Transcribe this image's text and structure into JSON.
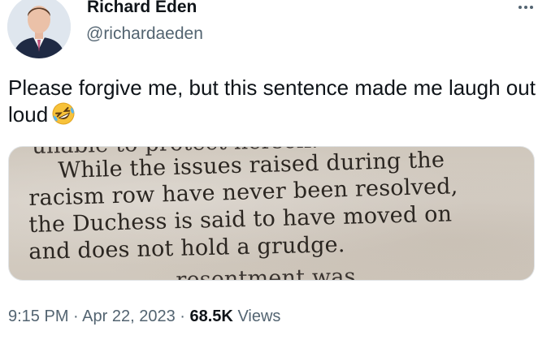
{
  "author": {
    "name": "Richard Eden",
    "handle": "@richardaeden"
  },
  "tweet": {
    "text": "Please forgive me, but this sentence made me laugh out loud",
    "emoji": "rolling-on-the-floor-laughing-emoji"
  },
  "media": {
    "lines": [
      "unable to protect herself.",
      "While the issues raised during the",
      "racism row have never been resolved,",
      "the Duchess is said to have moved on",
      "and does not hold a grudge.",
      "... resentment was"
    ]
  },
  "meta": {
    "time": "9:15 PM",
    "separator": "·",
    "date": "Apr 22, 2023",
    "views_count": "68.5K",
    "views_label": "Views"
  },
  "icons": {
    "more": "more-horizontal-icon"
  },
  "colors": {
    "text_primary": "#0f1419",
    "text_secondary": "#536471",
    "background": "#ffffff"
  }
}
